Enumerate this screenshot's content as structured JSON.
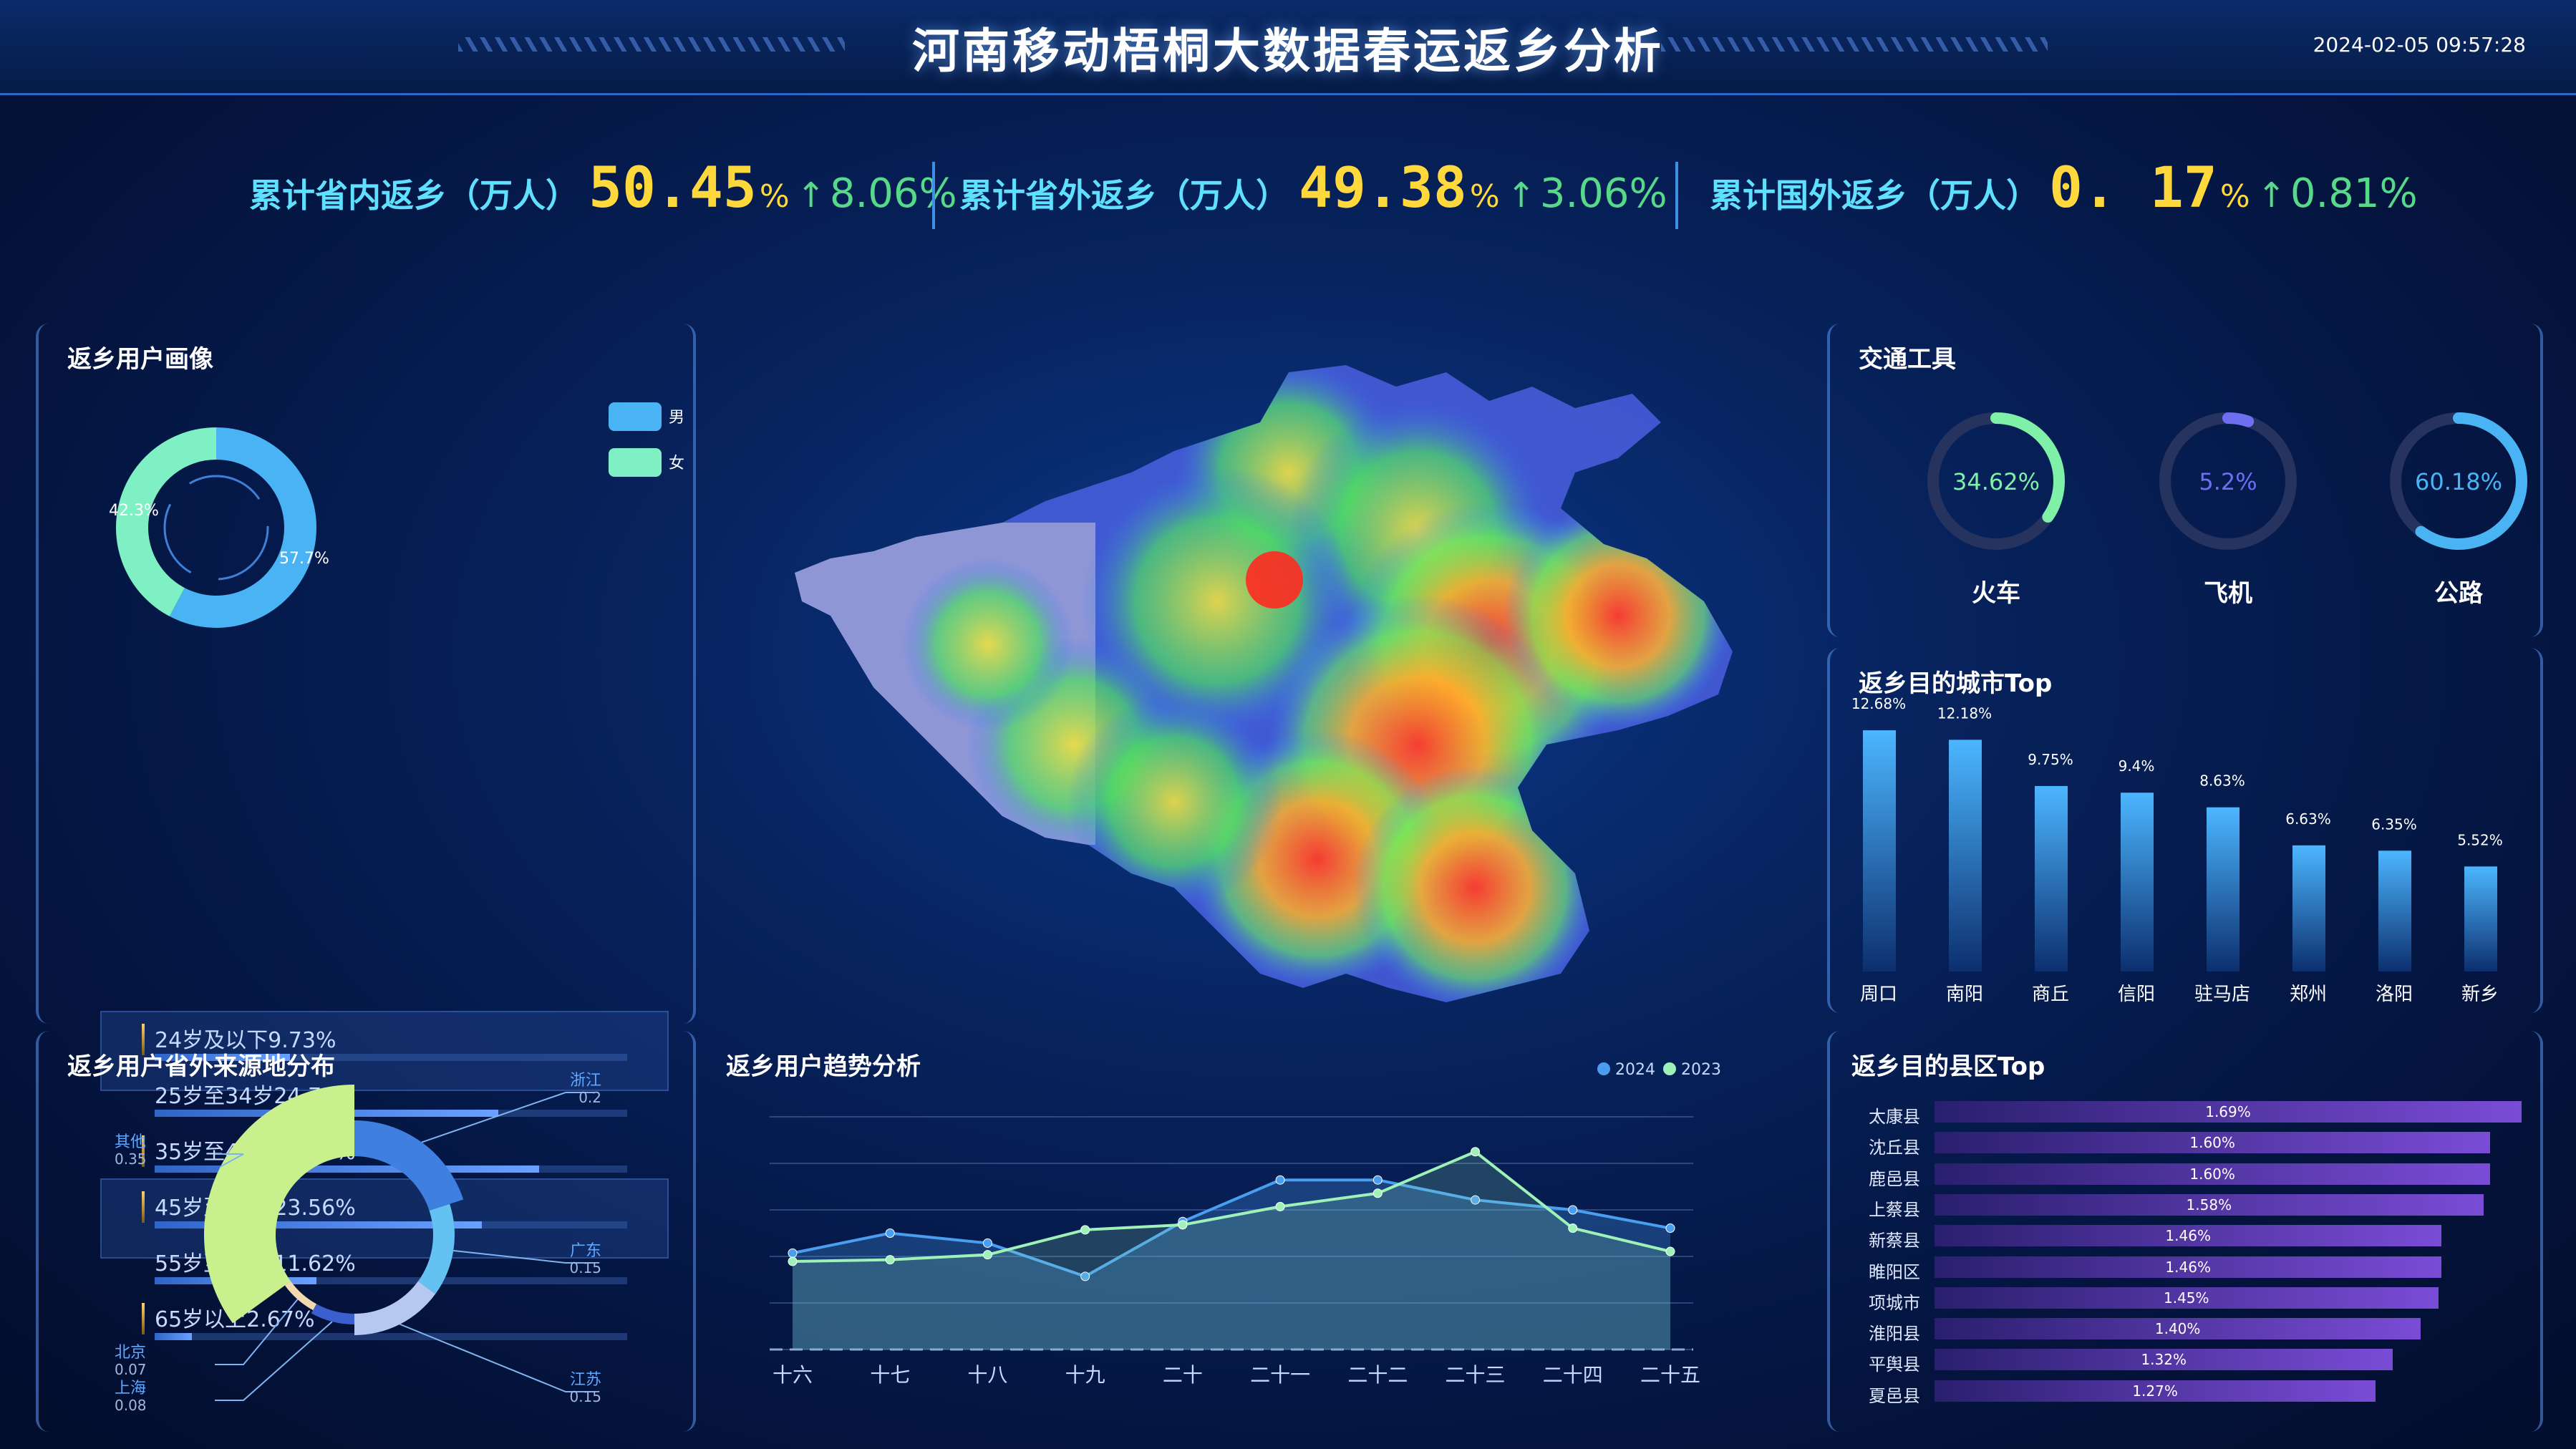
{
  "header": {
    "title": "河南移动梧桐大数据春运返乡分析",
    "datetime": "2024-02-05 09:57:28"
  },
  "kpis": [
    {
      "label": "累计省内返乡（万人）",
      "value": "50.45",
      "unit": "%",
      "change": "8.06%"
    },
    {
      "label": "累计省外返乡（万人）",
      "value": "49.38",
      "unit": "%",
      "change": "3.06%"
    },
    {
      "label": "累计国外返乡（万人）",
      "value": "0. 17",
      "unit": "%",
      "change": "0.81%"
    }
  ],
  "panels": {
    "profile": "返乡用户画像",
    "source": "返乡用户省外来源地分布",
    "trend": "返乡用户趋势分析",
    "transport": "交通工具",
    "cities": "返乡目的城市Top",
    "counties": "返乡目的县区Top"
  },
  "colors": {
    "accent": "#5fe0ff",
    "value": "#ffd83b",
    "up": "#57d98a",
    "male": "#4ab3f4",
    "female": "#7ef0c4"
  },
  "chart_data": [
    {
      "id": "gender",
      "type": "pie",
      "labels": [
        "男",
        "女"
      ],
      "values": [
        57.7,
        42.3
      ],
      "slice_labels": [
        "57.7%",
        "42.3%"
      ],
      "colors": [
        "#4ab3f4",
        "#7ef0c4"
      ],
      "legend": "top-right"
    },
    {
      "id": "age",
      "type": "bar",
      "orientation": "horizontal",
      "categories": [
        "24岁及以下",
        "25岁至34岁",
        "35岁至44岁",
        "45岁至54岁",
        "55岁至64岁",
        "65岁以上"
      ],
      "values": [
        9.73,
        24.74,
        27.66,
        23.56,
        11.62,
        2.67
      ],
      "labels": [
        "24岁及以下9.73%",
        "25岁至34岁24.74%",
        "35岁至44岁27.66%",
        "45岁至54岁23.56%",
        "55岁至64岁11.62%",
        "65岁以上2.67%"
      ]
    },
    {
      "id": "source",
      "type": "pie",
      "labels": [
        "浙江",
        "广东",
        "江苏",
        "上海",
        "北京",
        "其他"
      ],
      "values": [
        0.2,
        0.15,
        0.15,
        0.08,
        0.07,
        0.35
      ],
      "value_labels": [
        "0.2",
        "0.15",
        "0.15",
        "0.08",
        "0.07",
        "0.35"
      ],
      "colors": [
        "#3f7fe0",
        "#63c2f2",
        "#b7c8f0",
        "#3b5fcf",
        "#f2d9b0",
        "#c8f08c"
      ]
    },
    {
      "id": "trend",
      "type": "line",
      "x": [
        "十六",
        "十七",
        "十八",
        "十九",
        "二十",
        "二十一",
        "二十二",
        "二十三",
        "二十四",
        "二十五"
      ],
      "series": [
        {
          "name": "2024",
          "values": [
            58,
            70,
            64,
            44,
            77,
            102,
            102,
            90,
            84,
            73
          ],
          "color": "#4a9ef0"
        },
        {
          "name": "2023",
          "values": [
            53,
            54,
            57,
            72,
            75,
            86,
            94,
            119,
            73,
            59
          ],
          "color": "#9ef2b8"
        }
      ],
      "ylim": [
        0,
        140
      ],
      "grid": true,
      "legend": "top-right"
    },
    {
      "id": "transport",
      "type": "pie",
      "labels": [
        "火车",
        "飞机",
        "公路"
      ],
      "values": [
        34.62,
        5.2,
        60.18
      ],
      "value_labels": [
        "34.62%",
        "5.2%",
        "60.18%"
      ],
      "colors": [
        "#7ef0a8",
        "#6d6ff0",
        "#4ab3f4"
      ]
    },
    {
      "id": "cities",
      "type": "bar",
      "categories": [
        "周口",
        "南阳",
        "商丘",
        "信阳",
        "驻马店",
        "郑州",
        "洛阳",
        "新乡"
      ],
      "values": [
        12.68,
        12.18,
        9.75,
        9.4,
        8.63,
        6.63,
        6.35,
        5.52
      ],
      "value_labels": [
        "12.68%",
        "12.18%",
        "9.75%",
        "9.4%",
        "8.63%",
        "6.63%",
        "6.35%",
        "5.52%"
      ],
      "ylim": [
        0,
        14
      ]
    },
    {
      "id": "counties",
      "type": "bar",
      "orientation": "horizontal",
      "categories": [
        "太康县",
        "沈丘县",
        "鹿邑县",
        "上蔡县",
        "新蔡县",
        "睢阳区",
        "项城市",
        "淮阳县",
        "平舆县",
        "夏邑县"
      ],
      "values": [
        1.69,
        1.6,
        1.6,
        1.58,
        1.46,
        1.46,
        1.45,
        1.4,
        1.32,
        1.27
      ],
      "value_labels": [
        "1.69%",
        "1.60%",
        "1.60%",
        "1.58%",
        "1.46%",
        "1.46%",
        "1.45%",
        "1.40%",
        "1.32%",
        "1.27%"
      ]
    }
  ]
}
